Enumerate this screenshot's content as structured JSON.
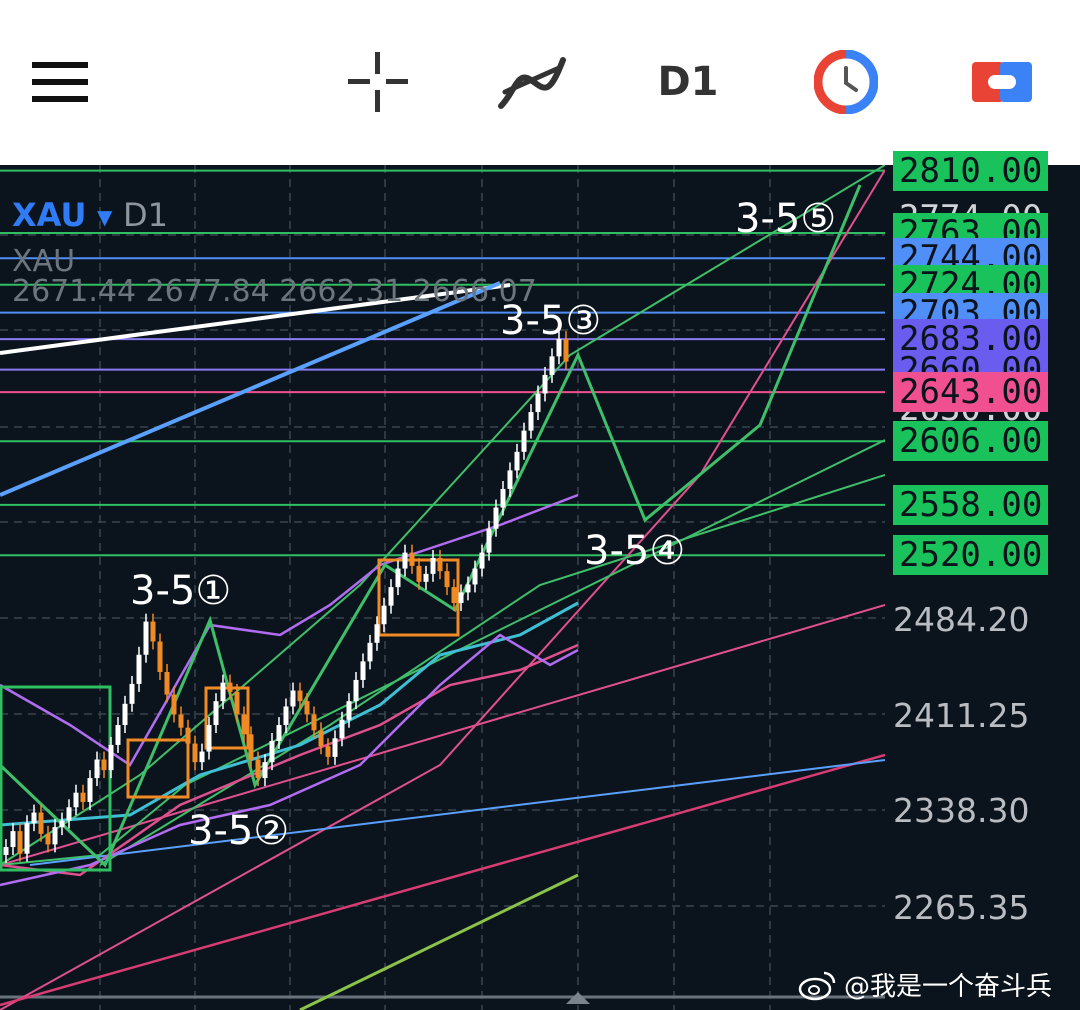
{
  "toolbar": {
    "menu_icon": "hamburger-menu-icon",
    "crosshair_icon": "crosshair-icon",
    "indicators_icon": "indicators-icon",
    "timeframe": "D1",
    "clock_icon": "clock-icon",
    "toggle_icon": "toggle-icon"
  },
  "legend": {
    "symbol": "XAU",
    "timeframe": "D1",
    "name": "XAU",
    "ohlc": "2671.44 2677.84 2662.31 2666.07"
  },
  "colors": {
    "background": "#0b141c",
    "green_label": "#19c25a",
    "blue_label": "#4f8ff7",
    "purple_label": "#6b5cf0",
    "pink_label": "#f0508f",
    "bull_candle": "#ffffff",
    "bear_candle": "#f08a24"
  },
  "chart_data": {
    "type": "candlestick",
    "symbol": "XAU",
    "timeframe": "D1",
    "ylim": [
      2220,
      2830
    ],
    "y_ticks": [
      "2484.20",
      "2411.25",
      "2338.30",
      "2265.35"
    ],
    "price_labels": [
      {
        "value": "2810.00",
        "color": "green"
      },
      {
        "value": "2774.00",
        "color": "none"
      },
      {
        "value": "2763.00",
        "color": "green"
      },
      {
        "value": "2744.00",
        "color": "blue"
      },
      {
        "value": "2724.00",
        "color": "green"
      },
      {
        "value": "2703.00",
        "color": "blue"
      },
      {
        "value": "2683.00",
        "color": "purple"
      },
      {
        "value": "2660.00",
        "color": "purple"
      },
      {
        "value": "2643.00",
        "color": "pink"
      },
      {
        "value": "2630.00",
        "color": "none"
      },
      {
        "value": "2606.00",
        "color": "green"
      },
      {
        "value": "2558.00",
        "color": "green"
      },
      {
        "value": "2520.00",
        "color": "green"
      }
    ],
    "wave_labels": [
      "3-5①",
      "3-5②",
      "3-5③",
      "3-5④",
      "3-5⑤"
    ],
    "candles_close": [
      2300,
      2312,
      2295,
      2318,
      2326,
      2310,
      2302,
      2315,
      2320,
      2330,
      2341,
      2334,
      2352,
      2366,
      2358,
      2377,
      2392,
      2408,
      2423,
      2445,
      2470,
      2455,
      2432,
      2415,
      2400,
      2390,
      2378,
      2364,
      2372,
      2392,
      2410,
      2424,
      2417,
      2400,
      2385,
      2366,
      2352,
      2364,
      2380,
      2392,
      2406,
      2418,
      2410,
      2400,
      2388,
      2376,
      2368,
      2382,
      2396,
      2410,
      2426,
      2440,
      2454,
      2468,
      2482,
      2496,
      2510,
      2522,
      2512,
      2500,
      2506,
      2518,
      2508,
      2496,
      2484,
      2492,
      2498,
      2510,
      2522,
      2540,
      2556,
      2570,
      2584,
      2598,
      2614,
      2628,
      2642,
      2656,
      2670,
      2683,
      2666
    ]
  },
  "watermark": "@我是一个奋斗兵"
}
